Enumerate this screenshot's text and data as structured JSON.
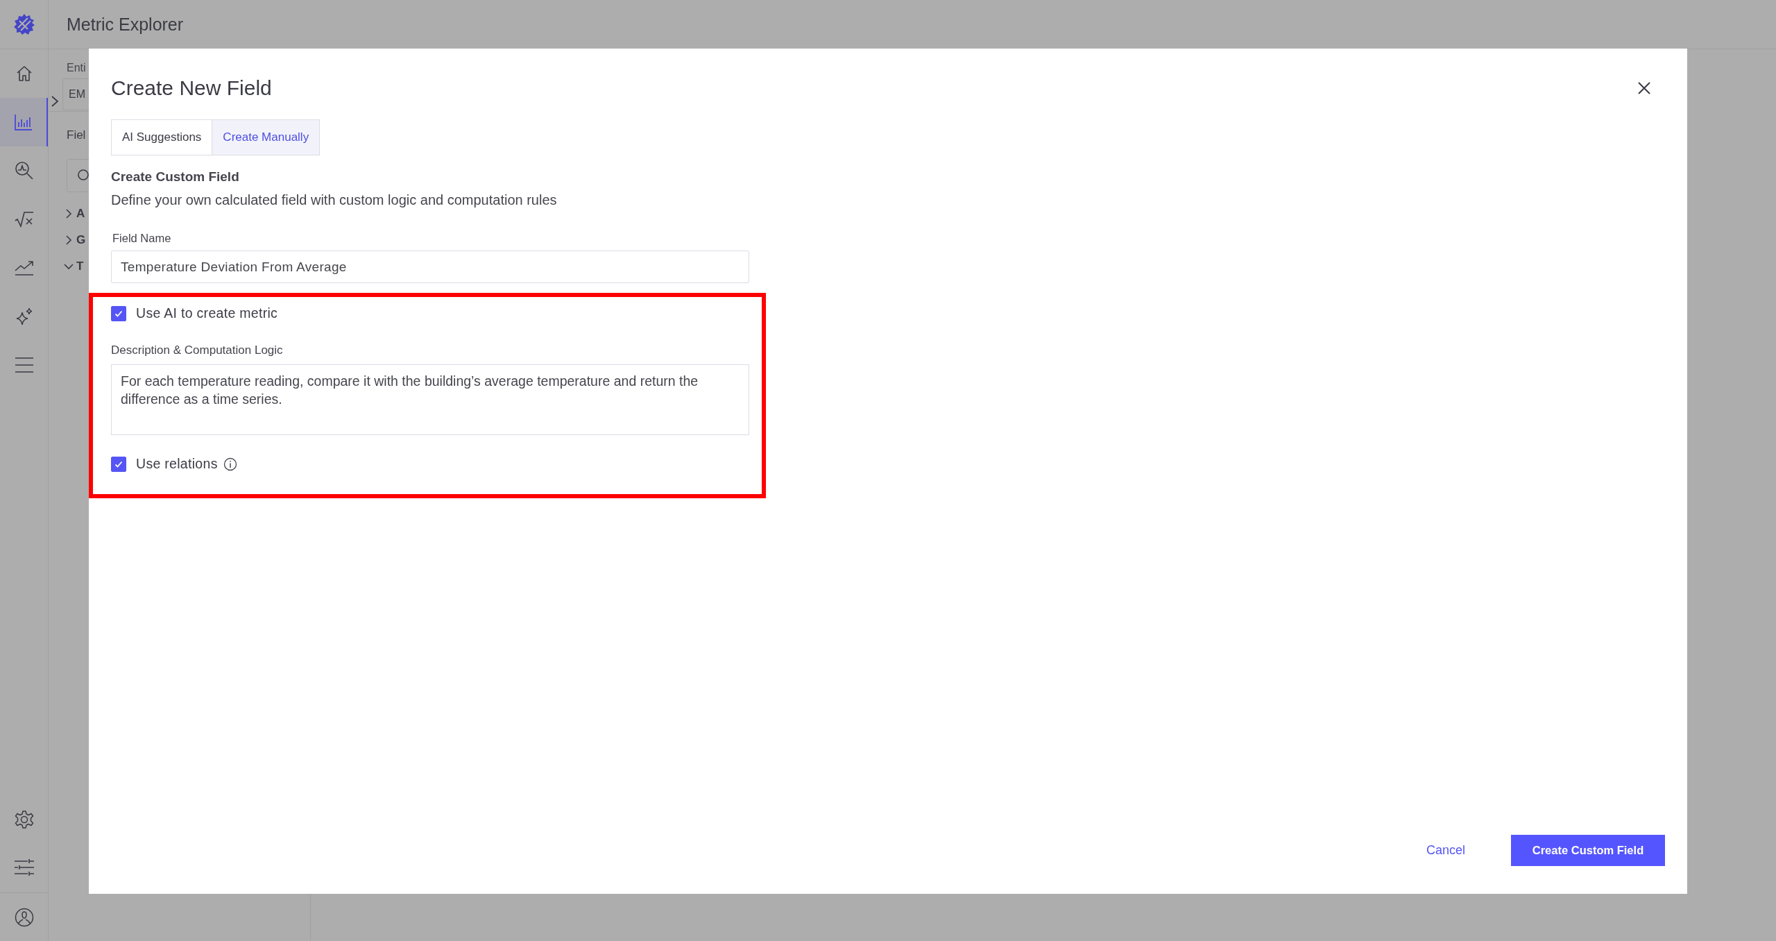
{
  "app": {
    "title": "Metric Explorer"
  },
  "sidebar": {
    "items": [
      {
        "kind": "home",
        "selected": false
      },
      {
        "kind": "chart",
        "selected": true
      },
      {
        "kind": "search",
        "selected": false
      },
      {
        "kind": "formula",
        "selected": false
      },
      {
        "kind": "trend",
        "selected": false
      },
      {
        "kind": "sparkle",
        "selected": false
      },
      {
        "kind": "menu",
        "selected": false
      }
    ],
    "bottom_items": [
      {
        "kind": "settings"
      },
      {
        "kind": "sliders"
      },
      {
        "kind": "user"
      }
    ]
  },
  "background_panel": {
    "entity_label": "Enti",
    "entity_value": "EM",
    "fields_label": "Fiel",
    "tree": [
      {
        "label": "A",
        "expanded": false
      },
      {
        "label": "G",
        "expanded": false
      },
      {
        "label": "T",
        "expanded": true
      }
    ]
  },
  "dialog": {
    "title": "Create New Field",
    "tabs": [
      {
        "label": "AI Suggestions",
        "selected": false
      },
      {
        "label": "Create Manually",
        "selected": true
      }
    ],
    "section_title": "Create Custom Field",
    "section_description": "Define your own calculated field with custom logic and computation rules",
    "field_name": {
      "label": "Field Name",
      "value": "Temperature Deviation From Average"
    },
    "use_ai": {
      "label": "Use AI to create metric",
      "checked": true
    },
    "logic": {
      "label": "Description & Computation Logic",
      "value": "For each temperature reading, compare it with the building’s average temperature and return the difference as a time series."
    },
    "use_relations": {
      "label": "Use relations",
      "checked": true
    },
    "buttons": {
      "cancel": "Cancel",
      "primary": "Create Custom Field"
    }
  }
}
